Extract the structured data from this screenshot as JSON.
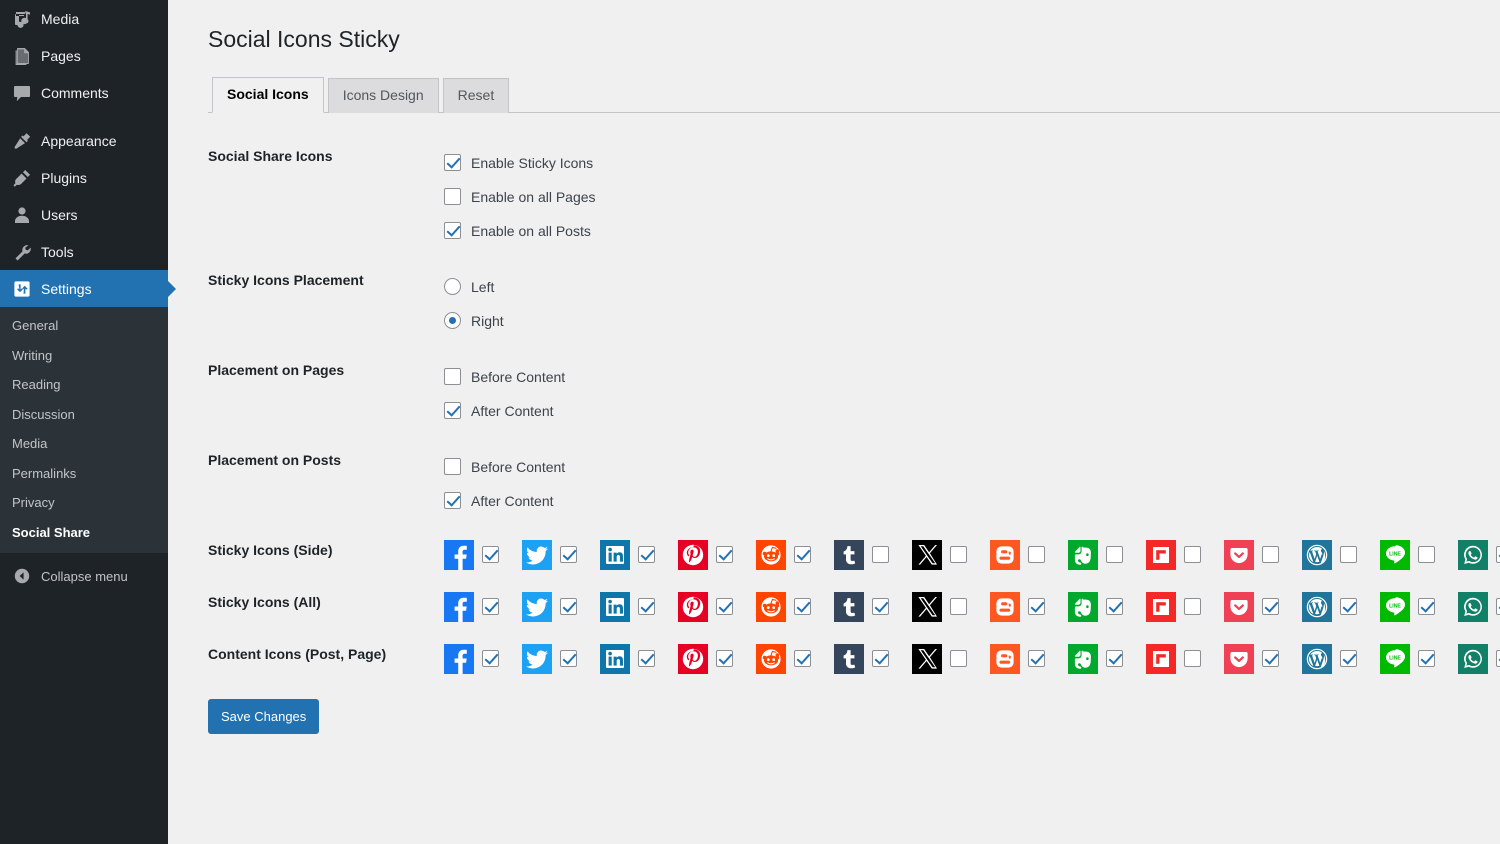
{
  "sidebar": {
    "items": [
      {
        "label": "Media",
        "icon": "media-icon",
        "current": false,
        "separator": false
      },
      {
        "label": "Pages",
        "icon": "pages-icon",
        "current": false,
        "separator": false
      },
      {
        "label": "Comments",
        "icon": "comments-icon",
        "current": false,
        "separator": false
      },
      {
        "label": "Appearance",
        "icon": "appearance-icon",
        "current": false,
        "separator": true
      },
      {
        "label": "Plugins",
        "icon": "plugins-icon",
        "current": false,
        "separator": false
      },
      {
        "label": "Users",
        "icon": "users-icon",
        "current": false,
        "separator": false
      },
      {
        "label": "Tools",
        "icon": "tools-icon",
        "current": false,
        "separator": false
      },
      {
        "label": "Settings",
        "icon": "settings-icon",
        "current": true,
        "separator": false
      }
    ],
    "submenu": [
      {
        "label": "General",
        "current": false
      },
      {
        "label": "Writing",
        "current": false
      },
      {
        "label": "Reading",
        "current": false
      },
      {
        "label": "Discussion",
        "current": false
      },
      {
        "label": "Media",
        "current": false
      },
      {
        "label": "Permalinks",
        "current": false
      },
      {
        "label": "Privacy",
        "current": false
      },
      {
        "label": "Social Share",
        "current": true
      }
    ],
    "collapse_label": "Collapse menu",
    "collapse_icon": "collapse-left-icon",
    "active_color": "#2271b1",
    "bg_color": "#1d2327",
    "submenu_bg_color": "#2c3338"
  },
  "header": {
    "title": "Social Icons Sticky"
  },
  "tabs": [
    {
      "label": "Social Icons",
      "active": true
    },
    {
      "label": "Icons Design",
      "active": false
    },
    {
      "label": "Reset",
      "active": false
    }
  ],
  "settings": {
    "rows": [
      {
        "label": "Social Share Icons",
        "type": "checkbox",
        "options": [
          {
            "label": "Enable Sticky Icons",
            "checked": true
          },
          {
            "label": "Enable on all Pages",
            "checked": false
          },
          {
            "label": "Enable on all Posts",
            "checked": true
          }
        ]
      },
      {
        "label": "Sticky Icons Placement",
        "type": "radio",
        "options": [
          {
            "label": "Left",
            "checked": false
          },
          {
            "label": "Right",
            "checked": true
          }
        ]
      },
      {
        "label": "Placement on Pages",
        "type": "checkbox",
        "options": [
          {
            "label": "Before Content",
            "checked": false
          },
          {
            "label": "After Content",
            "checked": true
          }
        ]
      },
      {
        "label": "Placement on Posts",
        "type": "checkbox",
        "options": [
          {
            "label": "Before Content",
            "checked": false
          },
          {
            "label": "After Content",
            "checked": true
          }
        ]
      }
    ]
  },
  "icon_rows": [
    {
      "label": "Sticky Icons (Side)",
      "icons": [
        {
          "name": "facebook-icon",
          "bg": "#1877f2",
          "checked": true
        },
        {
          "name": "twitter-icon",
          "bg": "#1da1f2",
          "checked": true
        },
        {
          "name": "linkedin-icon",
          "bg": "#0e76a8",
          "checked": true
        },
        {
          "name": "pinterest-icon",
          "bg": "#e60023",
          "checked": true
        },
        {
          "name": "reddit-icon",
          "bg": "#ff4500",
          "checked": true
        },
        {
          "name": "tumblr-icon",
          "bg": "#35465c",
          "checked": false
        },
        {
          "name": "x-icon",
          "bg": "#000000",
          "checked": false
        },
        {
          "name": "blogger-icon",
          "bg": "#ff5722",
          "checked": false
        },
        {
          "name": "evernote-icon",
          "bg": "#00a82d",
          "checked": false
        },
        {
          "name": "flipboard-icon",
          "bg": "#f52828",
          "checked": false
        },
        {
          "name": "pocket-icon",
          "bg": "#ef4056",
          "checked": false
        },
        {
          "name": "wordpress-icon",
          "bg": "#21759b",
          "checked": false
        },
        {
          "name": "line-icon",
          "bg": "#00b900",
          "checked": false
        },
        {
          "name": "whatsapp-icon",
          "bg": "#128066",
          "checked": true
        },
        {
          "name": "email-icon",
          "bg": "#eac36e",
          "checked": true
        }
      ]
    },
    {
      "label": "Sticky Icons (All)",
      "icons": [
        {
          "name": "facebook-icon",
          "bg": "#1877f2",
          "checked": true
        },
        {
          "name": "twitter-icon",
          "bg": "#1da1f2",
          "checked": true
        },
        {
          "name": "linkedin-icon",
          "bg": "#0e76a8",
          "checked": true
        },
        {
          "name": "pinterest-icon",
          "bg": "#e60023",
          "checked": true
        },
        {
          "name": "reddit-icon",
          "bg": "#ff4500",
          "checked": true
        },
        {
          "name": "tumblr-icon",
          "bg": "#35465c",
          "checked": true
        },
        {
          "name": "x-icon",
          "bg": "#000000",
          "checked": false
        },
        {
          "name": "blogger-icon",
          "bg": "#ff5722",
          "checked": true
        },
        {
          "name": "evernote-icon",
          "bg": "#00a82d",
          "checked": true
        },
        {
          "name": "flipboard-icon",
          "bg": "#f52828",
          "checked": false
        },
        {
          "name": "pocket-icon",
          "bg": "#ef4056",
          "checked": true
        },
        {
          "name": "wordpress-icon",
          "bg": "#21759b",
          "checked": true
        },
        {
          "name": "line-icon",
          "bg": "#00b900",
          "checked": true
        },
        {
          "name": "whatsapp-icon",
          "bg": "#128066",
          "checked": true
        },
        {
          "name": "email-icon",
          "bg": "#eac36e",
          "checked": true
        }
      ]
    },
    {
      "label": "Content Icons (Post, Page)",
      "icons": [
        {
          "name": "facebook-icon",
          "bg": "#1877f2",
          "checked": true
        },
        {
          "name": "twitter-icon",
          "bg": "#1da1f2",
          "checked": true
        },
        {
          "name": "linkedin-icon",
          "bg": "#0e76a8",
          "checked": true
        },
        {
          "name": "pinterest-icon",
          "bg": "#e60023",
          "checked": true
        },
        {
          "name": "reddit-icon",
          "bg": "#ff4500",
          "checked": true
        },
        {
          "name": "tumblr-icon",
          "bg": "#35465c",
          "checked": true
        },
        {
          "name": "x-icon",
          "bg": "#000000",
          "checked": false
        },
        {
          "name": "blogger-icon",
          "bg": "#ff5722",
          "checked": true
        },
        {
          "name": "evernote-icon",
          "bg": "#00a82d",
          "checked": true
        },
        {
          "name": "flipboard-icon",
          "bg": "#f52828",
          "checked": false
        },
        {
          "name": "pocket-icon",
          "bg": "#ef4056",
          "checked": true
        },
        {
          "name": "wordpress-icon",
          "bg": "#21759b",
          "checked": true
        },
        {
          "name": "line-icon",
          "bg": "#00b900",
          "checked": true
        },
        {
          "name": "whatsapp-icon",
          "bg": "#128066",
          "checked": true
        },
        {
          "name": "email-icon",
          "bg": "#eac36e",
          "checked": true
        }
      ]
    }
  ],
  "submit": {
    "label": "Save Changes",
    "color": "#2271b1"
  }
}
